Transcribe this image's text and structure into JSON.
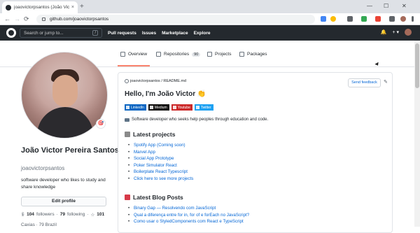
{
  "browser": {
    "tab_title": "joaovictorpsantos (João Victor P...",
    "url": "github.com/joaovictorpsantos",
    "new_tab": "+",
    "tab_close": "×",
    "window_controls": [
      "—",
      "☐",
      "✕"
    ],
    "nav": [
      "←",
      "→",
      "⟳"
    ]
  },
  "github_header": {
    "search_placeholder": "Search or jump to...",
    "search_shortcut": "/",
    "nav": [
      "Pull requests",
      "Issues",
      "Marketplace",
      "Explore"
    ],
    "right": [
      "🔔",
      "+ ▾"
    ]
  },
  "profile_tabs": {
    "overview": "Overview",
    "repositories": "Repositories",
    "repositories_count": "90",
    "projects": "Projects",
    "packages": "Packages"
  },
  "profile": {
    "name": "João Victor Pereira Santos",
    "login": "joaovictorpsantos",
    "bio": "software developer who likes to study and share knowledge",
    "edit_button": "Edit profile",
    "followers_count": "104",
    "followers_label": "followers",
    "following_count": "79",
    "following_label": "following",
    "stars_count": "101",
    "partial_line": "Caxias · 79 Brazil"
  },
  "readme": {
    "path": "joaovictorpsantos / README.md",
    "feedback": "Send feedback",
    "greeting": "Hello, I'm João Victor 👏",
    "badges": [
      {
        "label": "LinkedIn",
        "color": "#0a66c2"
      },
      {
        "label": "Medium",
        "color": "#12100e"
      },
      {
        "label": "Youtube",
        "color": "#cc2a2a"
      },
      {
        "label": "Twitter",
        "color": "#1da1f2"
      }
    ],
    "description": "Software developer who seeks help peoples through education and code.",
    "projects_title": "Latest projects",
    "projects": [
      "Spotify App (Coming soon)",
      "Marvel App",
      "Social App Prototype",
      "Poker Simulator React",
      "Boilerplate React Typescript",
      "Click here to see more projects"
    ],
    "blog_title": "Latest Blog Posts",
    "blog_posts": [
      "Binary Gap — Resolvendo com JavaScript",
      "Qual a diferença entre for in, for of e forEach no JavaScript?",
      "Como usar o StyledComponents com React e TypeScript"
    ]
  }
}
